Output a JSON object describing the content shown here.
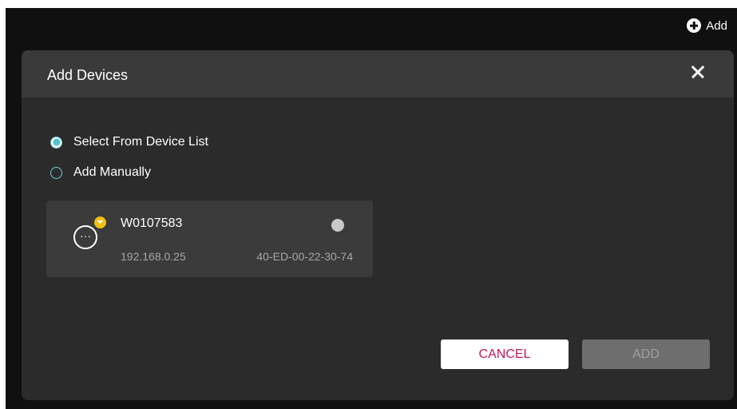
{
  "topbar": {
    "add_label": "Add",
    "add_icon": "plus-circle-icon"
  },
  "dialog": {
    "title": "Add Devices",
    "close_icon": "close-icon",
    "options": [
      {
        "label": "Select From Device List",
        "selected": true
      },
      {
        "label": "Add Manually",
        "selected": false
      }
    ],
    "device": {
      "name": "W0107583",
      "ip": "192.168.0.25",
      "mac": "40-ED-00-22-30-74",
      "icon": "device-more-icon",
      "badge_icon": "upgrade-badge-icon",
      "status": "offline"
    },
    "cancel_label": "CANCEL",
    "add_label": "ADD"
  },
  "colors": {
    "accent_radio": "#4ec3cb",
    "cancel_text": "#c2185b",
    "badge": "#f2c012",
    "dialog_bg": "#2b2b2b",
    "header_bg": "#3a3a3a"
  }
}
